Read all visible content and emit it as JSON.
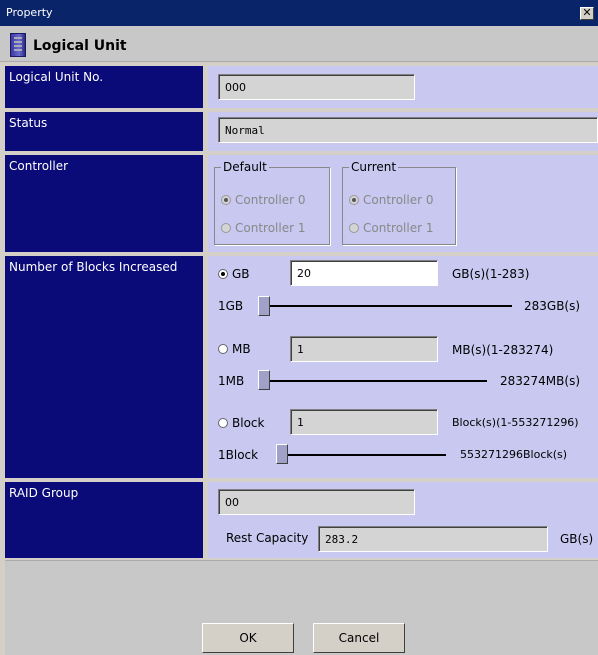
{
  "window": {
    "title": "Property",
    "close_glyph": "✕"
  },
  "header": {
    "title": "Logical Unit",
    "icon": "logical-unit-icon"
  },
  "logical_unit_no": {
    "label": "Logical Unit No.",
    "value": "000"
  },
  "status": {
    "label": "Status",
    "value": "Normal"
  },
  "controller": {
    "label": "Controller",
    "default": {
      "legend": "Default",
      "options": [
        "Controller 0",
        "Controller 1"
      ],
      "selected": "Controller 0"
    },
    "current": {
      "legend": "Current",
      "options": [
        "Controller 0",
        "Controller 1"
      ],
      "selected": "Controller 0"
    }
  },
  "blocks": {
    "label": "Number of Blocks Increased",
    "selected_unit": "GB",
    "gb": {
      "radio_label": "GB",
      "value": "20",
      "range_label": "GB(s)(1-283)",
      "min_label": "1GB",
      "max_label": "283GB(s)"
    },
    "mb": {
      "radio_label": "MB",
      "value": "1",
      "range_label": "MB(s)(1-283274)",
      "min_label": "1MB",
      "max_label": "283274MB(s)"
    },
    "block": {
      "radio_label": "Block",
      "value": "1",
      "range_label": "Block(s)(1-553271296)",
      "min_label": "1Block",
      "max_label": "553271296Block(s)"
    }
  },
  "raid_group": {
    "label": "RAID Group",
    "value": "00",
    "rest_label": "Rest Capacity",
    "rest_value": "283.2",
    "rest_unit": "GB(s)"
  },
  "buttons": {
    "ok": "OK",
    "cancel": "Cancel"
  },
  "colors": {
    "label_bg": "#0a0a78",
    "value_bg": "#c8c8f0",
    "title_bg": "#0a246a"
  }
}
